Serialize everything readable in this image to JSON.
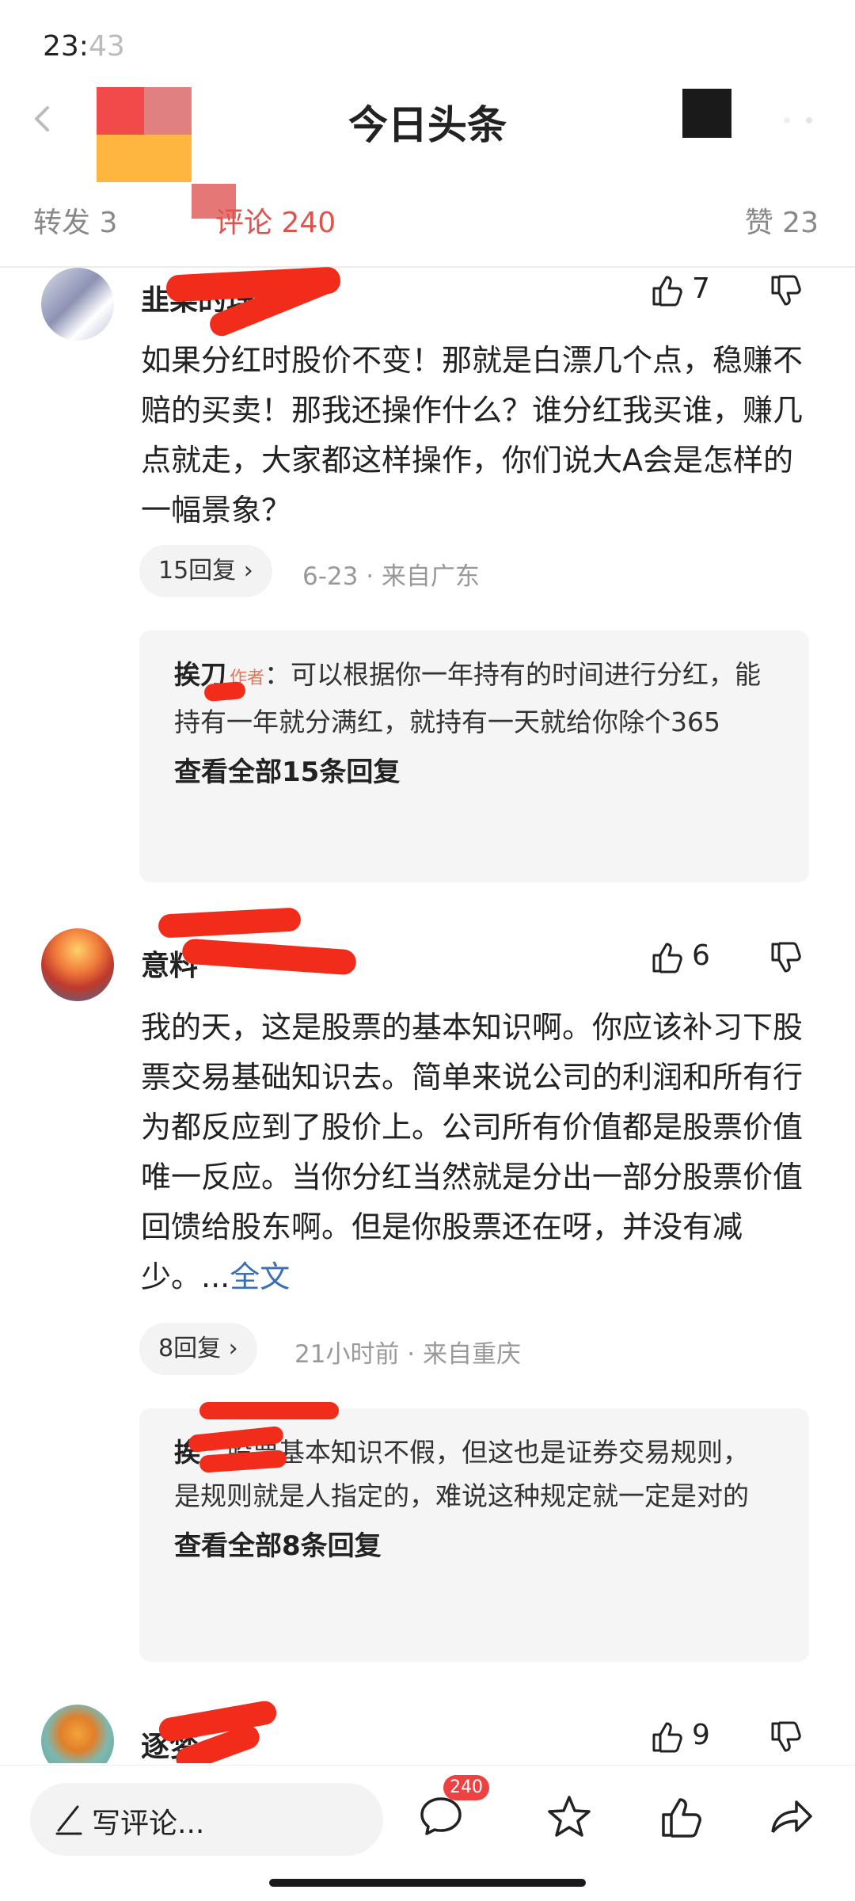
{
  "status": {
    "time_visible": "23:",
    "time_faded": "43"
  },
  "header": {
    "title": "今日头条"
  },
  "tabs": {
    "repost": "转发 3",
    "comment": "评论 240",
    "like": "赞 23"
  },
  "comments": [
    {
      "name_visible": "韭菜的理",
      "likes": "7",
      "text": "如果分红时股价不变！那就是白漂几个点，稳赚不赔的买卖！那我还操作什么？谁分红我买谁，赚几点就走，大家都这样操作，你们说大A会是怎样的一幅景象？",
      "replies_chip": "15回复 ›",
      "meta": "6-23 · 来自广东",
      "reply": {
        "author_visible": "挨刀",
        "author_tag": "作者",
        "content": "：可以根据你一年持有的时间进行分红，能持有一年就分满红，就持有一天就给你除个365",
        "view_all": "查看全部15条回复"
      }
    },
    {
      "name_visible": "意料",
      "likes": "6",
      "text": "我的天，这是股票的基本知识啊。你应该补习下股票交易基础知识去。简单来说公司的利润和所有行为都反应到了股价上。公司所有价值都是股票价值唯一反应。当你分红当然就是分出一部分股票价值回馈给股东啊。但是你股票还在呀，并没有减少。...",
      "more_link": "全文",
      "replies_chip": "8回复 ›",
      "meta": "21小时前 · 来自重庆",
      "reply": {
        "author_visible": "挨",
        "content": "：股票基本知识不假，但这也是证券交易规则，是规则就是人指定的，难说这种规定就一定是对的",
        "view_all": "查看全部8条回复"
      }
    },
    {
      "name_visible": "逐梦",
      "likes": "9"
    }
  ],
  "bottom_bar": {
    "write_placeholder": "写评论...",
    "comment_badge": "240"
  },
  "colors": {
    "accent_red": "#e0534d",
    "link_blue": "#3a6fb5",
    "redaction": "#f22c1b"
  }
}
